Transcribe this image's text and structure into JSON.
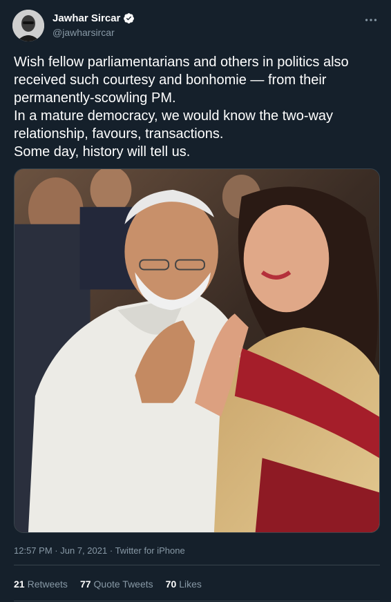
{
  "author": {
    "name": "Jawhar Sircar",
    "handle": "@jawharsircar"
  },
  "tweet": {
    "lines": [
      "Wish fellow parliamentarians and others in politics also",
      "received such courtesy and bonhomie — from their",
      "permanently-scowling PM.",
      "In a mature democracy, we would know the two-way",
      "relationship, favours, transactions.",
      "Some day, history will tell us."
    ]
  },
  "meta": {
    "time": "12:57 PM",
    "date": "Jun 7, 2021",
    "source": "Twitter for iPhone",
    "separator": "·"
  },
  "stats": {
    "retweets_count": "21",
    "retweets_label": "Retweets",
    "quote_count": "77",
    "quote_label": "Quote Tweets",
    "likes_count": "70",
    "likes_label": "Likes"
  },
  "colors": {
    "background": "#15202b",
    "secondary_text": "#8899a6",
    "verified": "#1da1f2",
    "divider": "#38444d"
  },
  "icons": {
    "verified": "verified-badge-icon",
    "more": "more-dots-icon"
  }
}
